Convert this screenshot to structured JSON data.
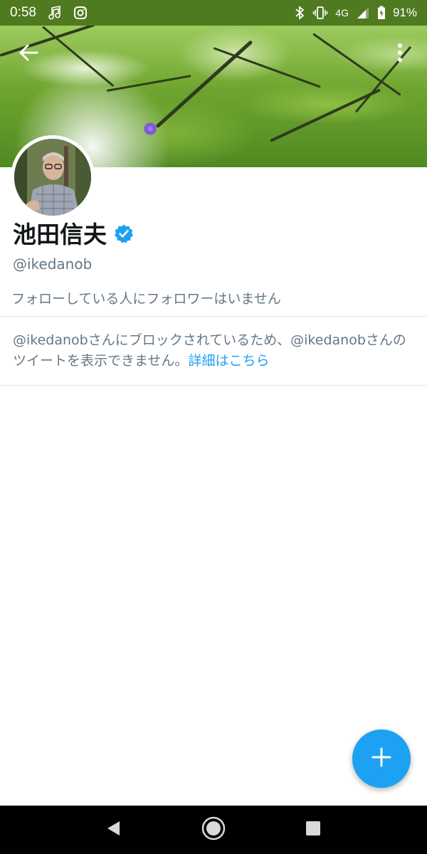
{
  "status_bar": {
    "time": "0:58",
    "network": "4G",
    "battery": "91%",
    "icons": [
      "music-note-icon",
      "instagram-icon",
      "bluetooth-icon",
      "vibrate-icon",
      "signal-icon",
      "battery-icon"
    ],
    "background_color": "#4f7a1f"
  },
  "header": {
    "back_icon": "arrow-left-icon",
    "more_icon": "more-vertical-icon"
  },
  "profile": {
    "display_name": "池田信夫",
    "verified_icon": "verified-badge-icon",
    "handle": "@ikedanob",
    "followers_note": "フォローしている人にフォロワーはいません"
  },
  "blocked_notice": {
    "text": "@ikedanobさんにブロックされているため、@ikedanobさんのツイートを表示できません。",
    "link_label": "詳細はこちら"
  },
  "fab": {
    "icon": "plus-icon",
    "color": "#1da1f2"
  },
  "nav_bar": {
    "buttons": [
      "back-triangle-icon",
      "home-circle-icon",
      "recents-square-icon"
    ]
  },
  "colors": {
    "accent": "#1da1f2",
    "secondary_text": "#657786",
    "primary_text": "#14171a",
    "divider": "#e1e8ed"
  }
}
